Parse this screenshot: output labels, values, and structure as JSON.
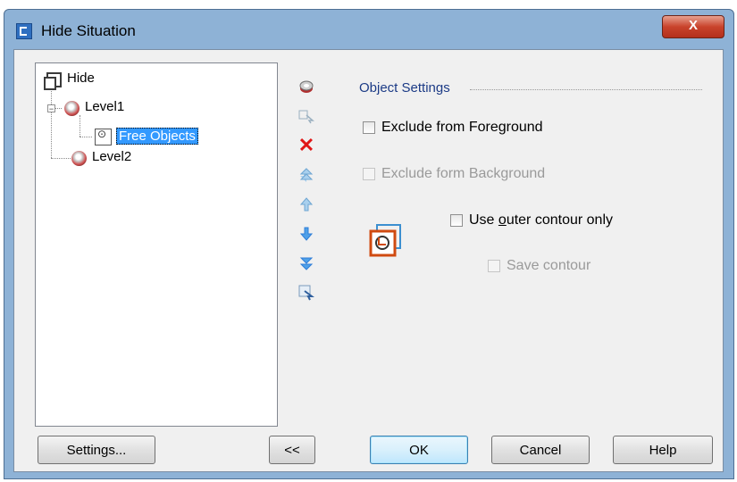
{
  "window": {
    "title": "Hide Situation",
    "close_label": "X"
  },
  "tree": {
    "root": "Hide",
    "level1": "Level1",
    "free_objects": "Free Objects",
    "level2": "Level2",
    "expander_symbol": "−"
  },
  "toolbar": {
    "icons": [
      "add-level-icon",
      "assign-icon",
      "delete-icon",
      "move-top-icon",
      "move-up-icon",
      "move-down-icon",
      "move-bottom-icon",
      "select-icon"
    ],
    "delete_color": "#e01515",
    "arrow_color": "#2f7ed8"
  },
  "object_settings": {
    "group_title": "Object Settings",
    "exclude_foreground": {
      "label": "Exclude from Foreground",
      "checked": false,
      "enabled": true
    },
    "exclude_background": {
      "label": "Exclude form Background",
      "checked": false,
      "enabled": false
    },
    "outer_contour": {
      "label_pre": "Use ",
      "label_accel": "o",
      "label_post": "uter contour only",
      "checked": false,
      "enabled": true
    },
    "save_contour": {
      "label": "Save contour",
      "checked": false,
      "enabled": false
    }
  },
  "buttons": {
    "settings": "Settings...",
    "collapse": "<<",
    "ok": "OK",
    "cancel": "Cancel",
    "help": "Help"
  },
  "colors": {
    "titlebar": "#8eb2d6",
    "dialog_bg": "#f0f0f0",
    "selection": "#3399ff",
    "group_title": "#1c3b86",
    "contour_orange": "#d04a10",
    "contour_blue": "#3c8fd0"
  }
}
